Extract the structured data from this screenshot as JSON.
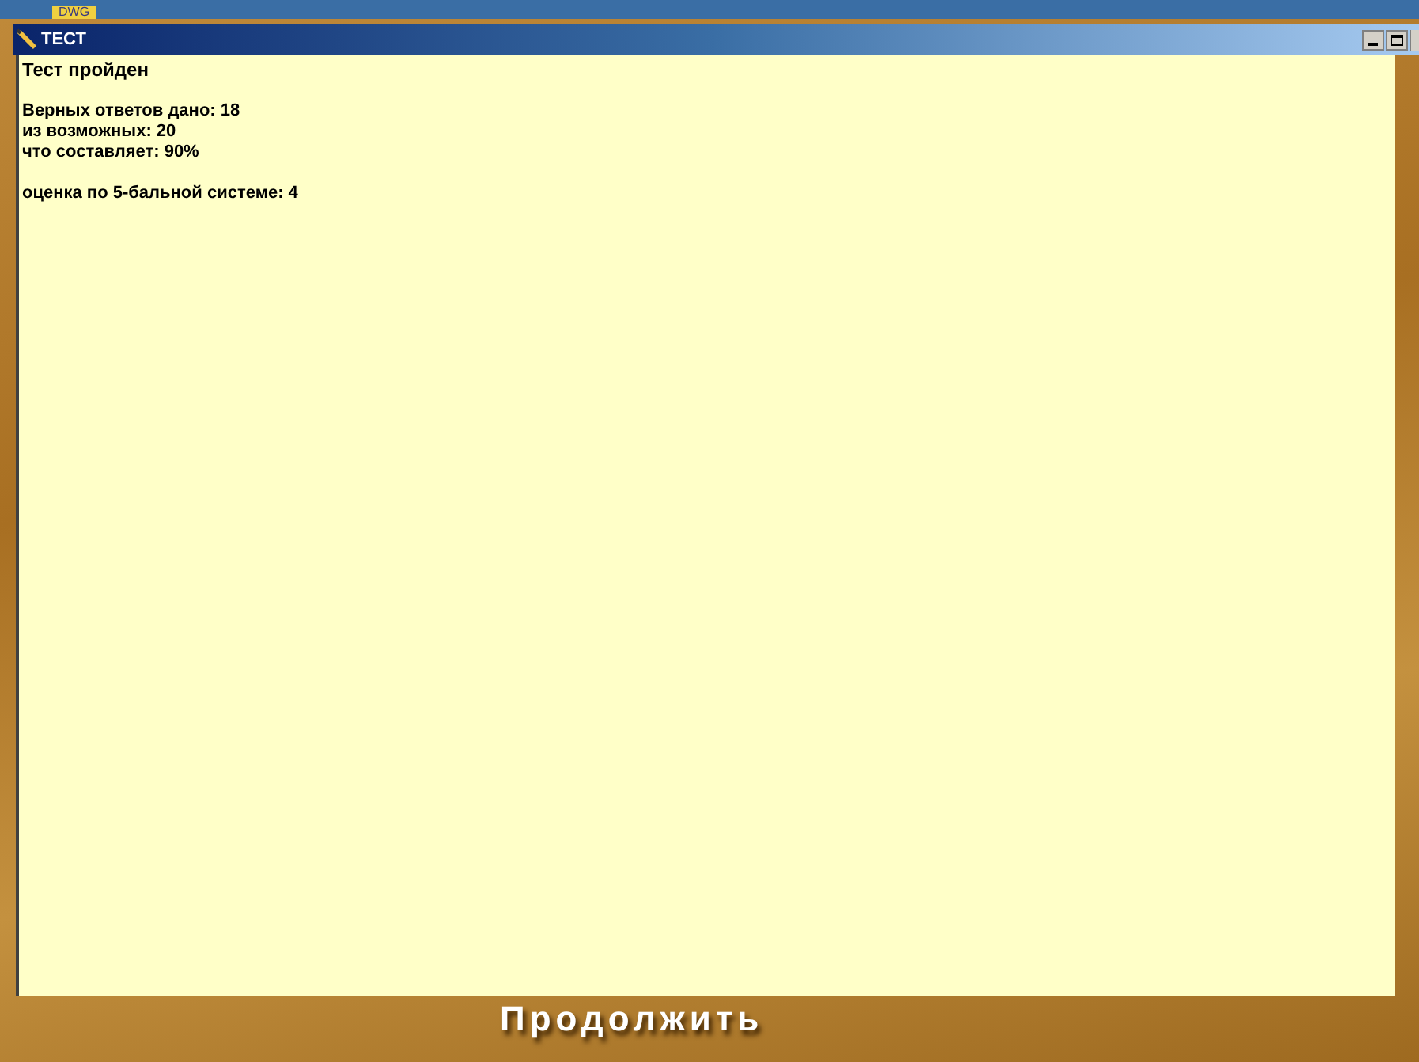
{
  "top_tab": {
    "label": "DWG"
  },
  "window": {
    "title": "ТЕСТ"
  },
  "result": {
    "heading": "Тест пройден",
    "lines": [
      "Верных ответов дано: 18",
      "из возможных: 20",
      "что составляет: 90%"
    ],
    "grade": "оценка по 5-бальной системе: 4"
  },
  "continue_button": {
    "label": "Продолжить"
  }
}
